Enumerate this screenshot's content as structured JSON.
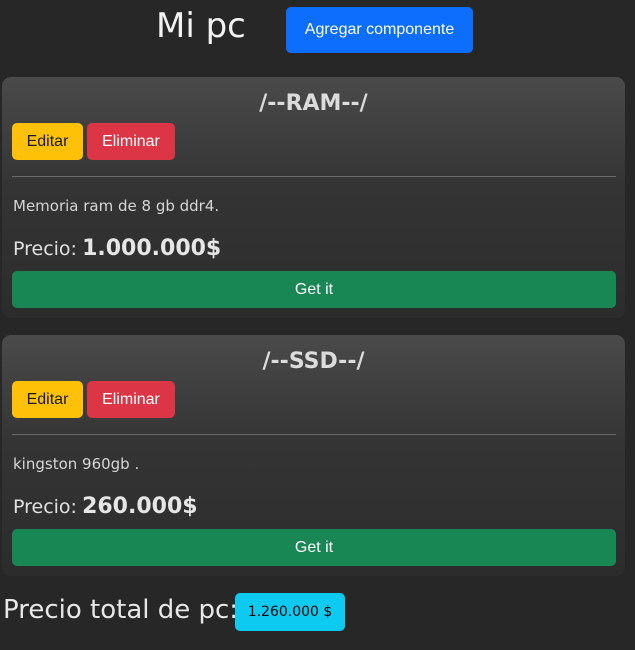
{
  "header": {
    "title": "Mi pc",
    "add_button_label": "Agregar componente"
  },
  "components": [
    {
      "title": "/--RAM--/",
      "edit_label": "Editar",
      "delete_label": "Eliminar",
      "description": "Memoria ram de 8 gb ddr4.",
      "price_label": "Precio:",
      "price_value": "1.000.000$",
      "get_label": "Get it"
    },
    {
      "title": "/--SSD--/",
      "edit_label": "Editar",
      "delete_label": "Eliminar",
      "description": "kingston 960gb .",
      "price_label": "Precio:",
      "price_value": "260.000$",
      "get_label": "Get it"
    }
  ],
  "total": {
    "label": "Precio total de pc:",
    "value": "1.260.000 $"
  },
  "colors": {
    "background": "#272727",
    "primary": "#0d6efd",
    "warning": "#ffc107",
    "danger": "#dc3545",
    "success": "#198754",
    "info": "#0dcaf0"
  }
}
